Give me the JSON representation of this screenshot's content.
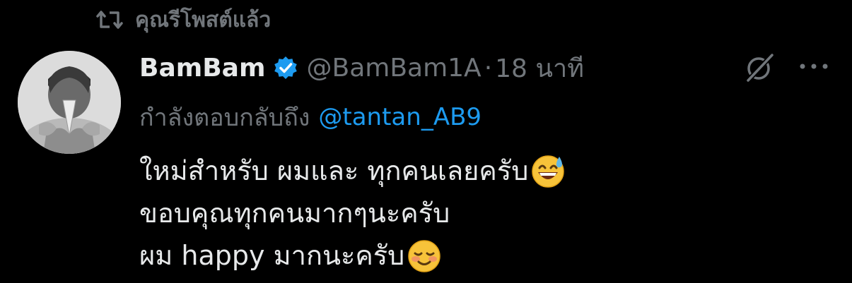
{
  "repost": {
    "label": "คุณรีโพสต์แล้ว",
    "icon": "repost-icon"
  },
  "tweet": {
    "author": {
      "display_name": "BamBam",
      "handle": "@BamBam1A",
      "verified": true,
      "avatar": "avatar"
    },
    "separator": "·",
    "time": "18 นาที",
    "reply_to": {
      "prefix": "กำลังตอบกลับถึง",
      "mention": "@tantan_AB9"
    },
    "lines": [
      {
        "text": "ใหม่สำหรับ ผมและ ทุกคนเลยครับ",
        "emoji": "grinning-sweat-emoji"
      },
      {
        "text": "ขอบคุณทุกคนมากๆนะครับ",
        "emoji": ""
      },
      {
        "text": "ผม happy มากนะครับ",
        "emoji": "smiling-blush-emoji"
      }
    ],
    "actions": {
      "grok_icon": "grok-icon",
      "more_icon": "more-icon"
    }
  },
  "colors": {
    "background": "#000000",
    "text_primary": "#e7e9ea",
    "text_secondary": "#71767b",
    "accent": "#1d9bf0"
  }
}
